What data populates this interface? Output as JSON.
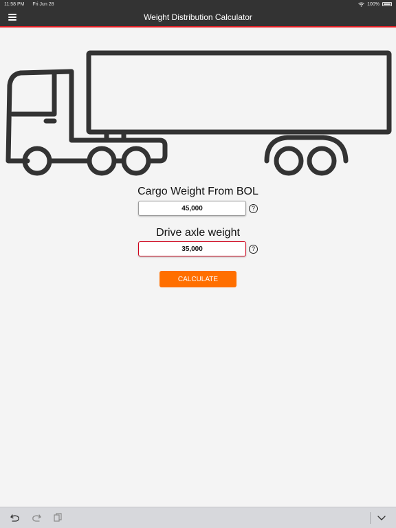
{
  "status_bar": {
    "time": "11:58 PM",
    "date": "Fri Jun 28",
    "battery": "100%"
  },
  "nav": {
    "title": "Weight Distribution Calculator",
    "menu_icon": "hamburger-menu-icon"
  },
  "form": {
    "cargo_label": "Cargo Weight From BOL",
    "cargo_value": "45,000",
    "drive_label": "Drive axle weight",
    "drive_value": "35,000",
    "help_glyph": "?",
    "calculate_label": "CALCULATE"
  },
  "toolbar": {
    "icons": [
      "undo-icon",
      "redo-icon",
      "paste-icon",
      "keyboard-dismiss-icon"
    ]
  },
  "colors": {
    "nav_bg": "#333333",
    "nav_accent": "#e31e24",
    "button": "#ff6f00",
    "input_error_border": "#d0021b",
    "background": "#f4f4f4"
  }
}
